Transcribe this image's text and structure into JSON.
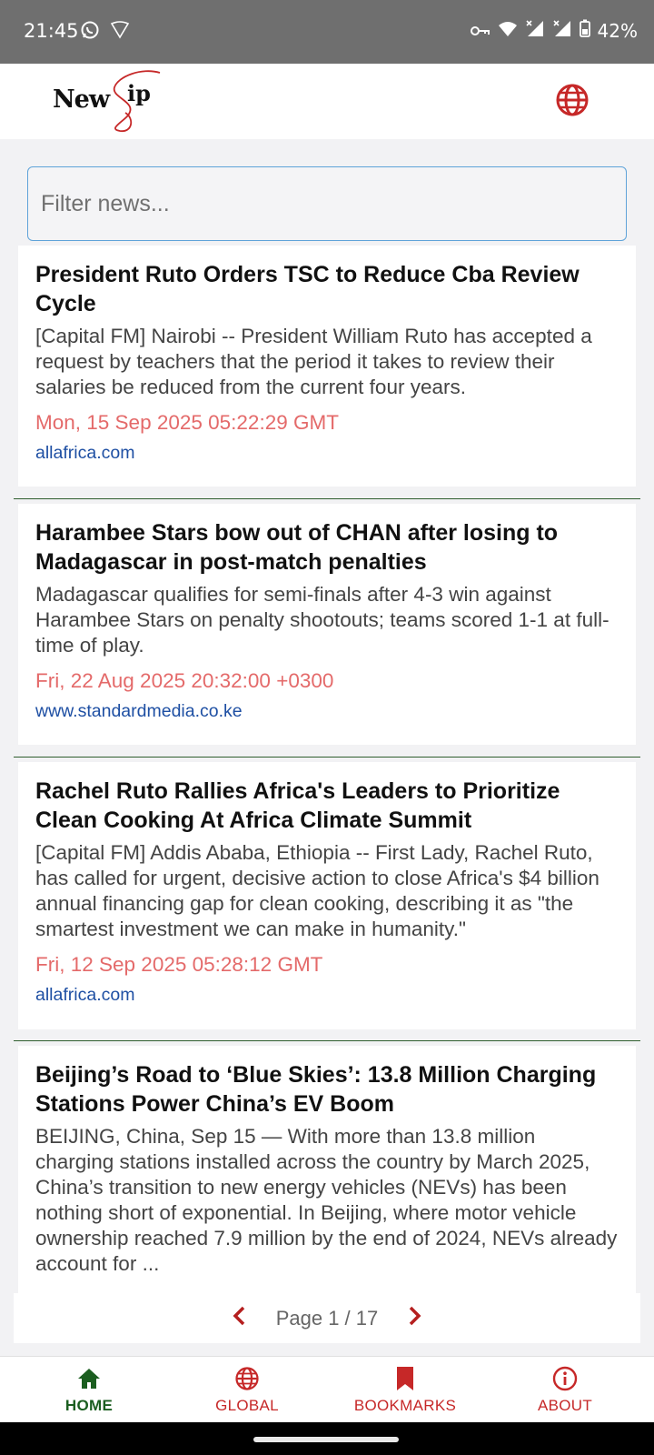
{
  "status_bar": {
    "time": "21:45",
    "battery": "42%",
    "icons": [
      "whatsapp-icon",
      "signal-outline-icon",
      "vpn-key-icon",
      "wifi-icon",
      "signal-x-icon",
      "signal-x-icon",
      "battery-icon"
    ]
  },
  "header": {
    "logo_text": "New",
    "logo_flourish": "ip",
    "globe_icon": "globe-icon",
    "accent_color": "#c62828"
  },
  "filter": {
    "placeholder": "Filter news...",
    "value": ""
  },
  "articles": [
    {
      "title": "President Ruto Orders TSC to Reduce Cba Review Cycle",
      "description": "[Capital FM] Nairobi -- President William Ruto has accepted a request by teachers that the period it takes to review their salaries be reduced from the current four years.",
      "date": "Mon, 15 Sep 2025 05:22:29 GMT",
      "source": "allafrica.com"
    },
    {
      "title": "Harambee Stars bow out of CHAN after losing to Madagascar in post-match penalties",
      "description": "Madagascar qualifies for semi-finals after 4-3 win against Harambee Stars on penalty shootouts; teams scored 1-1 at full-time of play.",
      "date": "Fri, 22 Aug 2025 20:32:00 +0300",
      "source": "www.standardmedia.co.ke"
    },
    {
      "title": "Rachel Ruto Rallies Africa's Leaders to Prioritize Clean Cooking At Africa Climate Summit",
      "description": "[Capital FM] Addis Ababa, Ethiopia -- First Lady, Rachel Ruto, has called for urgent, decisive action to close Africa's $4 billion annual financing gap for clean cooking, describing it as \"the smartest investment we can make in humanity.\"",
      "date": "Fri, 12 Sep 2025 05:28:12 GMT",
      "source": "allafrica.com"
    },
    {
      "title": "Beijing’s Road to ‘Blue Skies’: 13.8 Million Charging Stations Power China’s EV Boom",
      "description": "BEIJING, China, Sep 15 — With more than 13.8 million charging stations installed across the country by March 2025, China’s transition to new energy vehicles (NEVs) has been nothing short of exponential. In Beijing, where motor vehicle ownership reached 7.9 million by the end of 2024, NEVs already account for ...",
      "date": "",
      "source": ""
    }
  ],
  "pagination": {
    "label": "Page 1 / 17",
    "prev_icon": "chevron-left-icon",
    "next_icon": "chevron-right-icon"
  },
  "bottom_nav": {
    "items": [
      {
        "label": "HOME",
        "icon": "home-icon",
        "active": true,
        "color": "#1b5e20"
      },
      {
        "label": "GLOBAL",
        "icon": "globe-icon",
        "active": false,
        "color": "#c62828"
      },
      {
        "label": "BOOKMARKS",
        "icon": "bookmark-icon",
        "active": false,
        "color": "#c62828"
      },
      {
        "label": "ABOUT",
        "icon": "info-icon",
        "active": false,
        "color": "#c62828"
      }
    ]
  }
}
